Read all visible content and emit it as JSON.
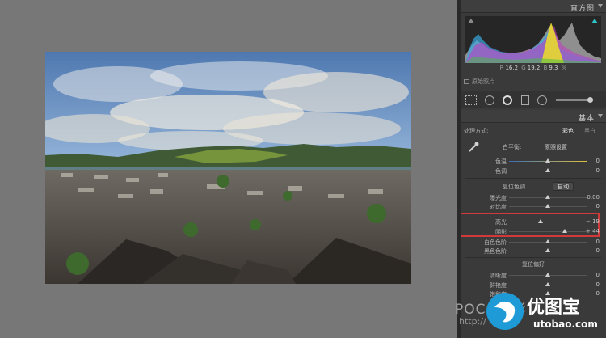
{
  "panel": {
    "histogram_title": "直方图",
    "rgb": {
      "r_label": "R",
      "r_value": "16.2",
      "g_label": "G",
      "g_value": "19.2",
      "b_label": "B",
      "b_value": "9.3",
      "unit": "%"
    },
    "original_photo_label": "原始照片",
    "basic_title": "基本",
    "treatment": {
      "label": "处理方式:",
      "color": "彩色",
      "bw": "黑白"
    },
    "white_balance": {
      "label": "白平衡:",
      "value": "原照设置 :"
    },
    "temp": {
      "label": "色温",
      "value": "0",
      "level": 0.5
    },
    "tint": {
      "label": "色调",
      "value": "0",
      "level": 0.5
    },
    "tone_section": "复位色调",
    "auto_label": "自动",
    "exposure": {
      "label": "曝光度",
      "value": "0.00",
      "level": 0.5
    },
    "contrast": {
      "label": "对比度",
      "value": "0",
      "level": 0.5
    },
    "highlights": {
      "label": "高光",
      "value": "− 19",
      "level": 0.405
    },
    "shadows": {
      "label": "阴影",
      "value": "+ 44",
      "level": 0.72
    },
    "whites": {
      "label": "白色色阶",
      "value": "0",
      "level": 0.5
    },
    "blacks": {
      "label": "黑色色阶",
      "value": "0",
      "level": 0.5
    },
    "presence_section": "复位偏好",
    "clarity": {
      "label": "清晰度",
      "value": "0",
      "level": 0.5
    },
    "vibrance": {
      "label": "鲜艳度",
      "value": "0",
      "level": 0.5
    },
    "saturation": {
      "label": "饱和度",
      "value": "0",
      "level": 0.5
    }
  },
  "watermark": {
    "poco": "POCO摄影",
    "url": "http://",
    "site_title": "优图宝",
    "site_domain": "utobao.com"
  },
  "colors": {
    "accent_red": "#d03a3a",
    "bg_canvas": "#777777",
    "panel": "#3a3a3a"
  }
}
